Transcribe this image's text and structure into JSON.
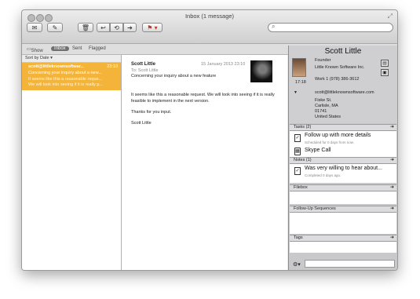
{
  "window": {
    "title": "Inbox (1 message)"
  },
  "toolbar": {
    "buttons": [
      {
        "name": "get-mail-button",
        "glyph": "✉"
      },
      {
        "name": "compose-button",
        "glyph": "✎"
      },
      {
        "name": "delete-button",
        "glyph": "🗑"
      },
      {
        "name": "reply-button",
        "glyph": "↩"
      },
      {
        "name": "reply-all-button",
        "glyph": "⟲"
      },
      {
        "name": "forward-button",
        "glyph": "➔"
      },
      {
        "name": "flag-button",
        "glyph": "⚑ ▾"
      }
    ],
    "search_placeholder": ""
  },
  "mailbar": {
    "show_label": "Show",
    "inbox_label": "Inbox",
    "sent_label": "Sent",
    "flagged_label": "Flagged"
  },
  "message_list": {
    "sort_label": "Sort by Date ▾",
    "items": [
      {
        "from": "scott@littleknownsoftwar...",
        "time": "23:10",
        "subject": "Concerning your inquiry about a new...",
        "preview_1": "It seems like this a reasonable reque...",
        "preview_2": "We will look into seeing if it is really p..."
      }
    ]
  },
  "reading_pane": {
    "from": "Scott Little",
    "date": "15 January 2013 23:10",
    "to": "To: Scott Little",
    "subject": "Concerning your inquiry about a new feature",
    "body_1": "It seems like this a reasonable request. We will look into seeing if it is really feasible to implement in the next version.",
    "body_2": "Thanks for you input.",
    "signature": "Scott Little"
  },
  "contact_panel": {
    "name": "Scott Little",
    "role": "Founder",
    "company": "Little Known Software Inc.",
    "work_phone": "Work   1 (978) 386-3612",
    "local_time": "17:18",
    "email": "scott@littleknownsoftware.com",
    "address_1": "Fiske St.",
    "address_2": "Carlisle, MA",
    "address_3": "01741",
    "address_4": "United States",
    "tasks_header": "Tasks (2)",
    "task_title": "Follow up with more details",
    "task_sub": "Scheduled for 0 days from now.",
    "task2_title": "Skype Call",
    "notes_header": "Notes (1)",
    "note_title": "Was very willing to hear about...",
    "note_sub": "Completed 0 days ago.",
    "filebox_header": "Filebox",
    "followup_header": "Follow-Up Sequences",
    "tags_header": "Tags"
  },
  "colors": {
    "selection": "#f4b43a",
    "panel_bg": "#c9c9cc"
  }
}
